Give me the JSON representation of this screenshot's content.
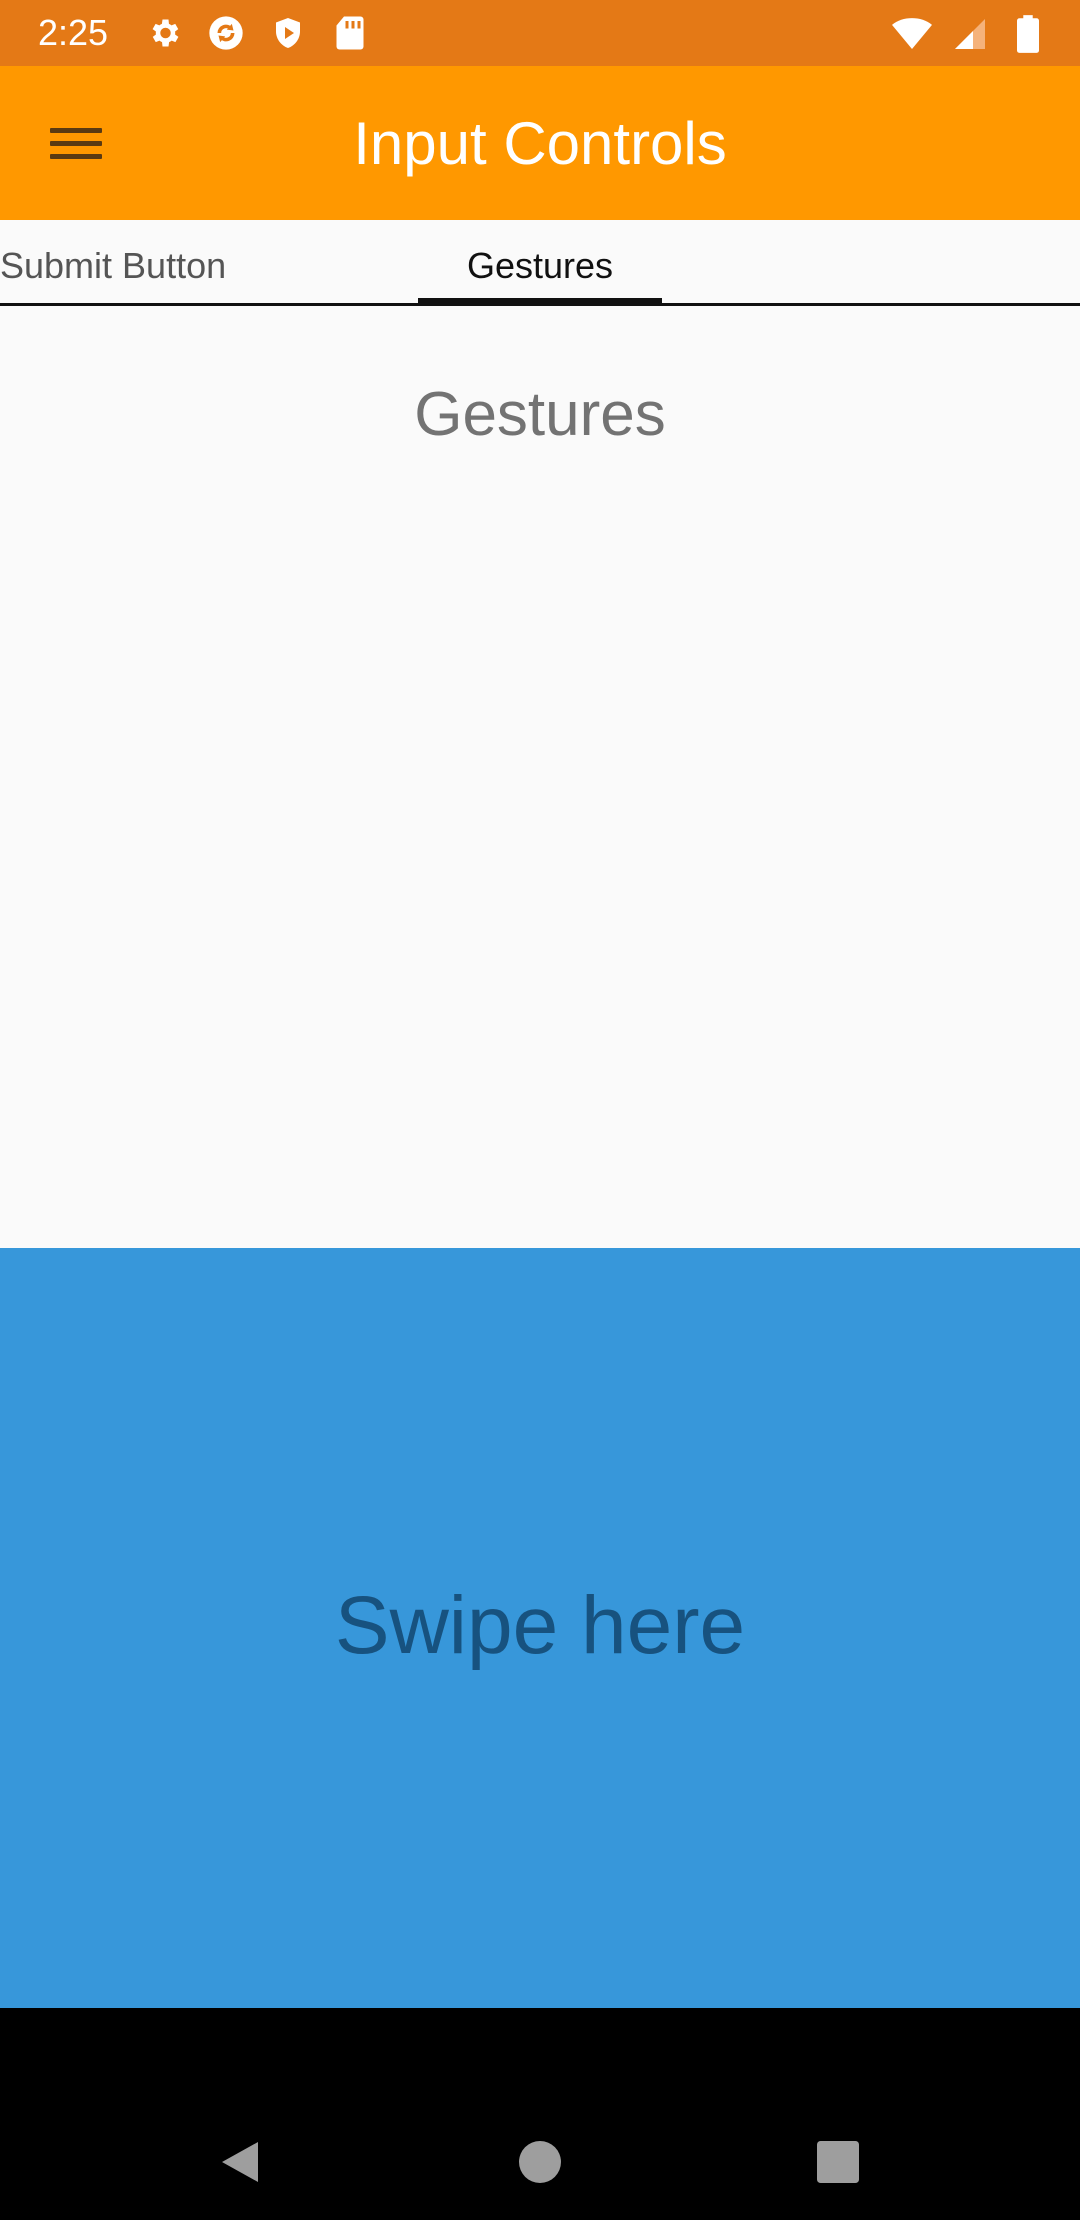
{
  "status_bar": {
    "time": "2:25",
    "left_icons": [
      "settings-icon",
      "sync-icon",
      "shield-play-icon",
      "sd-card-icon"
    ],
    "right_icons": [
      "wifi-icon",
      "signal-icon",
      "battery-icon"
    ]
  },
  "app_bar": {
    "title": "Input Controls",
    "menu_icon": "hamburger-menu-icon"
  },
  "tabs": [
    {
      "label": "Submit Button",
      "selected": false
    },
    {
      "label": "Gestures",
      "selected": true
    }
  ],
  "content": {
    "heading": "Gestures"
  },
  "swipe_area": {
    "label": "Swipe here"
  },
  "nav_bar": {
    "buttons": [
      "back-icon",
      "home-icon",
      "recents-icon"
    ]
  },
  "colors": {
    "status_bar": "#e47916",
    "app_bar": "#ff9800",
    "swipe_area": "#3797da",
    "swipe_text": "#17527f",
    "heading_text": "#737373"
  }
}
